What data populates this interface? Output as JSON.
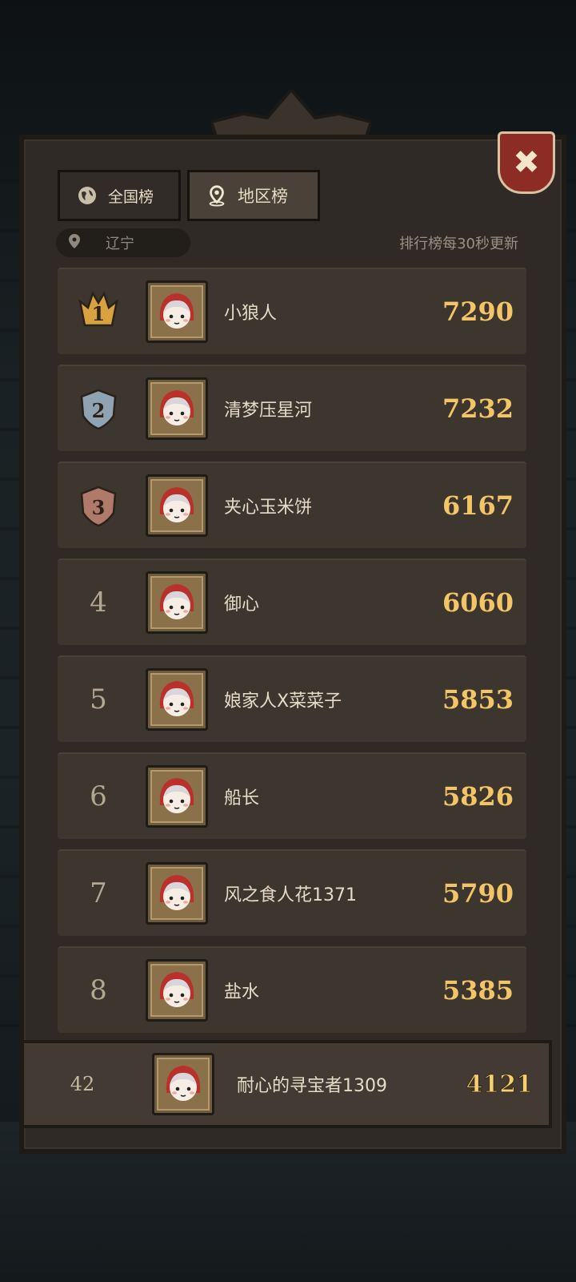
{
  "tabs": [
    {
      "label": "全国榜",
      "icon": "globe-icon",
      "active": false
    },
    {
      "label": "地区榜",
      "icon": "location-pin-icon",
      "active": true
    }
  ],
  "region_filter": {
    "value": "辽宁",
    "icon": "location-pin-icon"
  },
  "update_notice": "排行榜每30秒更新",
  "close_icon": "close-icon",
  "leaderboard": [
    {
      "rank": "1",
      "name": "小狼人",
      "score": "7290",
      "medal": "gold"
    },
    {
      "rank": "2",
      "name": "清梦压星河",
      "score": "7232",
      "medal": "silver"
    },
    {
      "rank": "3",
      "name": "夹心玉米饼",
      "score": "6167",
      "medal": "bronze"
    },
    {
      "rank": "4",
      "name": "御心",
      "score": "6060"
    },
    {
      "rank": "5",
      "name": "娘家人X菜菜子",
      "score": "5853"
    },
    {
      "rank": "6",
      "name": "船长",
      "score": "5826"
    },
    {
      "rank": "7",
      "name": "风之食人花1371",
      "score": "5790"
    },
    {
      "rank": "8",
      "name": "盐水",
      "score": "5385"
    }
  ],
  "my_entry": {
    "rank": "42",
    "name": "耐心的寻宝者1309",
    "score": "4121"
  },
  "colors": {
    "panel": "#2f2a25",
    "row": "#3d362f",
    "score": "#f3c567",
    "gold": "#d8a23e",
    "silver": "#8fa3b3",
    "bronze": "#b07a6a",
    "close": "#8c2c25"
  }
}
